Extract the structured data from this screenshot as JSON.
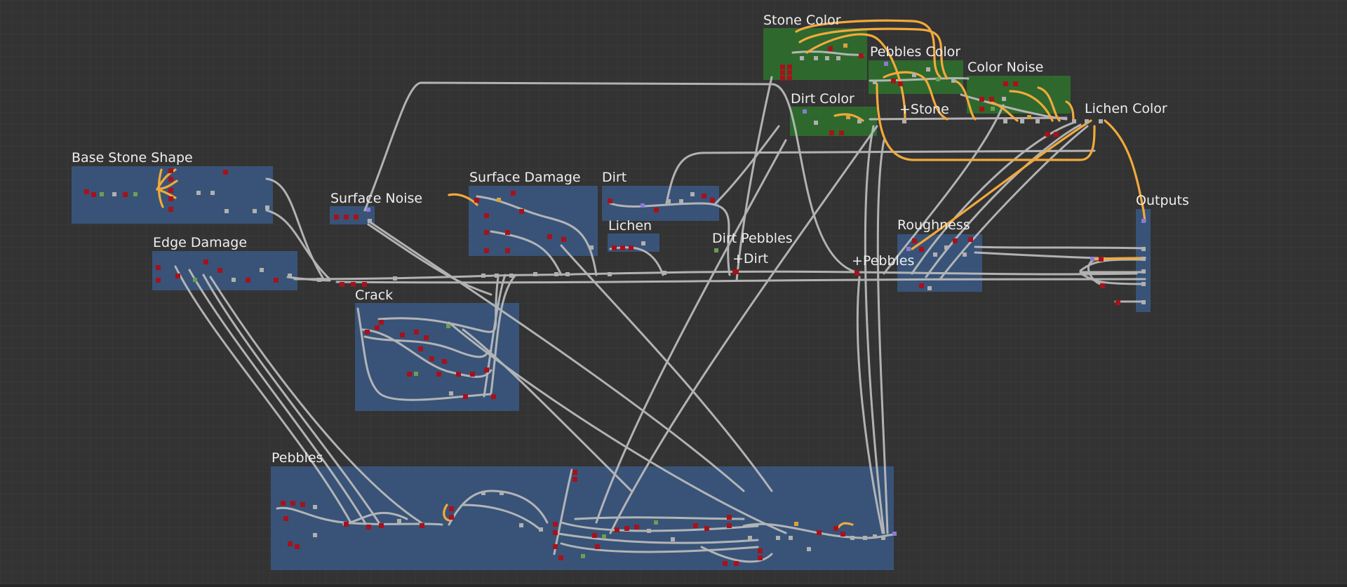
{
  "colors": {
    "background": "#333333",
    "frame_blue": "#3a5c8a",
    "frame_green": "#2e702c",
    "wire_gray": "#bdbdbd",
    "wire_orange": "#f2a93b",
    "node_red": "#a6121c",
    "node_gray": "#b0b0b0"
  },
  "frames": [
    {
      "id": "base-stone-shape",
      "label": "Base Stone Shape",
      "color": "blue"
    },
    {
      "id": "edge-damage",
      "label": "Edge Damage",
      "color": "blue"
    },
    {
      "id": "surface-noise",
      "label": "Surface Noise",
      "color": "blue"
    },
    {
      "id": "surface-damage",
      "label": "Surface Damage",
      "color": "blue"
    },
    {
      "id": "dirt",
      "label": "Dirt",
      "color": "blue"
    },
    {
      "id": "lichen",
      "label": "Lichen",
      "color": "blue"
    },
    {
      "id": "crack",
      "label": "Crack",
      "color": "blue"
    },
    {
      "id": "stone-color",
      "label": "Stone Color",
      "color": "green"
    },
    {
      "id": "pebbles-color",
      "label": "Pebbles Color",
      "color": "green"
    },
    {
      "id": "color-noise",
      "label": "Color Noise",
      "color": "green"
    },
    {
      "id": "dirt-color",
      "label": "Dirt Color",
      "color": "green"
    },
    {
      "id": "lichen-color",
      "label": "Lichen Color",
      "color": "none"
    },
    {
      "id": "outputs",
      "label": "Outputs",
      "color": "blue"
    },
    {
      "id": "roughness",
      "label": "Roughness",
      "color": "blue"
    },
    {
      "id": "pebbles",
      "label": "Pebbles",
      "color": "blue"
    }
  ],
  "labels": {
    "plus_stone": "+Stone",
    "dirt_pebbles": "Dirt Pebbles",
    "plus_dirt": "+Dirt",
    "plus_pebbles": "+Pebbles"
  }
}
